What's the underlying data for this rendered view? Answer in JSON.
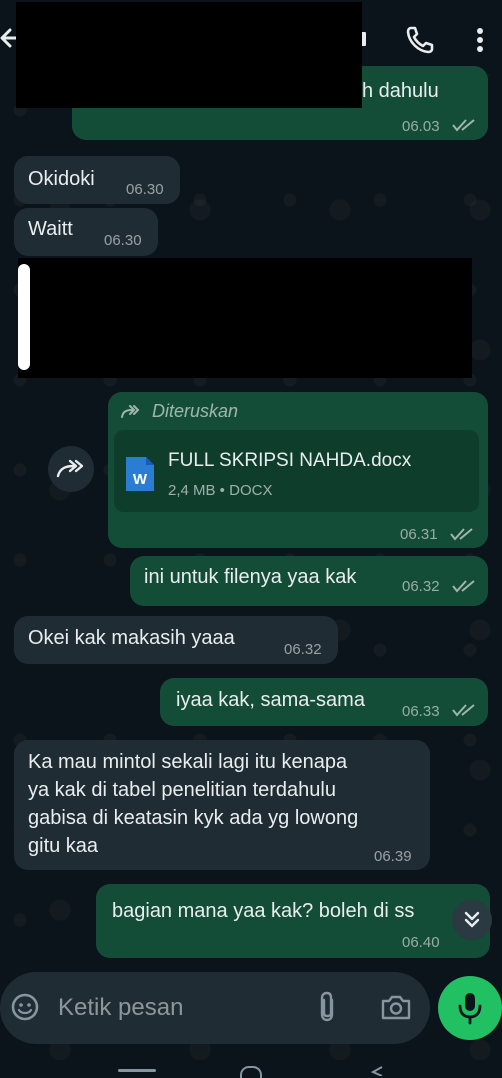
{
  "header": {
    "back_icon": "arrow-left-icon",
    "call_icon": "phone-icon",
    "menu_icon": "more-vert-icon"
  },
  "messages": [
    {
      "dir": "out",
      "text": "h dahulu",
      "time": "06.03",
      "status": "read"
    },
    {
      "dir": "in",
      "text": "Okidoki",
      "time": "06.30"
    },
    {
      "dir": "in",
      "text": "Waitt",
      "time": "06.30"
    },
    {
      "dir": "out",
      "forwarded_label": "Diteruskan",
      "file_name": "FULL SKRIPSI NAHDA.docx",
      "file_meta": "2,4 MB • DOCX",
      "time": "06.31",
      "status": "read"
    },
    {
      "dir": "out",
      "text": "ini untuk filenya yaa kak",
      "time": "06.32",
      "status": "read"
    },
    {
      "dir": "in",
      "text": "Okei kak makasih yaaa",
      "time": "06.32"
    },
    {
      "dir": "out",
      "text": "iyaa kak, sama-sama",
      "time": "06.33",
      "status": "read"
    },
    {
      "dir": "in",
      "lines": [
        "Ka mau mintol sekali lagi itu kenapa",
        "ya kak di tabel penelitian terdahulu",
        "gabisa di keatasin kyk ada yg lowong",
        "gitu kaa"
      ],
      "time": "06.39"
    },
    {
      "dir": "out",
      "text": "bagian mana yaa kak? boleh di ss",
      "time": "06.40",
      "status": "read"
    }
  ],
  "input": {
    "placeholder": "Ketik pesan",
    "emoji_icon": "sticker-icon",
    "attach_icon": "paperclip-icon",
    "camera_icon": "camera-icon",
    "mic_icon": "mic-icon"
  },
  "colors": {
    "background": "#0b141a",
    "outgoing_bubble": "#144d37",
    "incoming_bubble": "#202c33",
    "accent": "#21c063"
  }
}
